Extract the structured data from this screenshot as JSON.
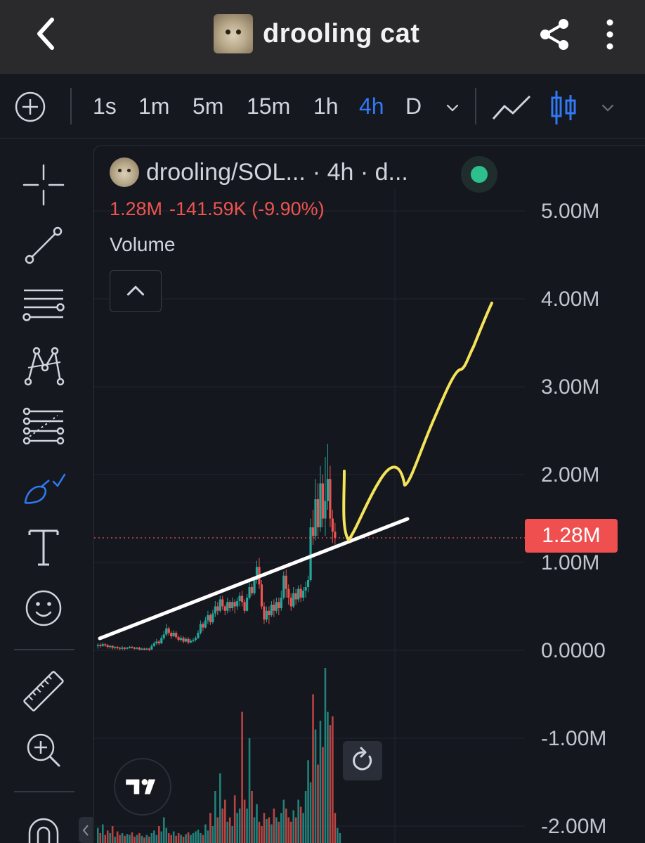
{
  "header": {
    "title": "drooling cat",
    "icons": [
      "back-icon",
      "share-icon",
      "more-icon"
    ]
  },
  "timeframes": {
    "items": [
      "1s",
      "1m",
      "5m",
      "15m",
      "1h",
      "4h",
      "D"
    ],
    "active": "4h"
  },
  "sidebar": {
    "tools": [
      "crosshair-icon",
      "trend-line-icon",
      "horizontal-lines-icon",
      "pattern-icon",
      "fib-icon",
      "brush-icon",
      "text-icon",
      "emoji-icon",
      "ruler-icon",
      "zoom-in-icon",
      "magnet-icon"
    ],
    "active_tool": "brush-icon"
  },
  "legend": {
    "symbol": "drooling/SOL...",
    "interval": "· 4h · d...",
    "last": "1.28M",
    "change": "-141.59K (-9.90%)",
    "status_color": "#2cc08d"
  },
  "volume_title": "Volume",
  "price_axis": [
    "5.00M",
    "4.00M",
    "3.00M",
    "2.00M",
    "1.00M",
    "0.0000",
    "-1.00M",
    "-2.00M"
  ],
  "current_price": "1.28M",
  "colors": {
    "up": "#26a69a",
    "down": "#ef5350",
    "accent": "#3179f5",
    "drawing_line": "#ffffff",
    "drawing_brush": "#f5e35a"
  },
  "chart_data": {
    "type": "candlestick",
    "ylim": [
      -2.0,
      5.0
    ],
    "unit": "M",
    "last_price": 1.28,
    "candles": [
      [
        0.05,
        0.06,
        0.02,
        0.08
      ],
      [
        0.06,
        0.05,
        0.03,
        0.08
      ],
      [
        0.05,
        0.07,
        0.04,
        0.09
      ],
      [
        0.07,
        0.06,
        0.04,
        0.08
      ],
      [
        0.06,
        0.04,
        0.02,
        0.07
      ],
      [
        0.04,
        0.05,
        0.02,
        0.06
      ],
      [
        0.05,
        0.03,
        0.01,
        0.06
      ],
      [
        0.03,
        0.04,
        0.01,
        0.05
      ],
      [
        0.04,
        0.03,
        0.01,
        0.05
      ],
      [
        0.03,
        0.02,
        0.0,
        0.04
      ],
      [
        0.02,
        0.03,
        0.0,
        0.05
      ],
      [
        0.03,
        0.02,
        0.0,
        0.04
      ],
      [
        0.02,
        0.03,
        0.01,
        0.04
      ],
      [
        0.03,
        0.04,
        0.02,
        0.05
      ],
      [
        0.04,
        0.03,
        0.02,
        0.05
      ],
      [
        0.03,
        0.02,
        0.01,
        0.04
      ],
      [
        0.02,
        0.03,
        0.01,
        0.04
      ],
      [
        0.03,
        0.01,
        0.0,
        0.04
      ],
      [
        0.01,
        0.02,
        0.0,
        0.03
      ],
      [
        0.02,
        0.01,
        0.0,
        0.03
      ],
      [
        0.01,
        0.02,
        0.0,
        0.03
      ],
      [
        0.02,
        0.01,
        -0.01,
        0.03
      ],
      [
        0.01,
        0.05,
        0.0,
        0.07
      ],
      [
        0.05,
        0.08,
        0.04,
        0.1
      ],
      [
        0.08,
        0.1,
        0.06,
        0.13
      ],
      [
        0.1,
        0.08,
        0.06,
        0.12
      ],
      [
        0.08,
        0.14,
        0.07,
        0.17
      ],
      [
        0.14,
        0.18,
        0.12,
        0.22
      ],
      [
        0.18,
        0.25,
        0.16,
        0.3
      ],
      [
        0.25,
        0.2,
        0.17,
        0.27
      ],
      [
        0.2,
        0.16,
        0.13,
        0.22
      ],
      [
        0.16,
        0.2,
        0.15,
        0.23
      ],
      [
        0.2,
        0.15,
        0.13,
        0.22
      ],
      [
        0.15,
        0.12,
        0.1,
        0.17
      ],
      [
        0.12,
        0.14,
        0.1,
        0.17
      ],
      [
        0.14,
        0.1,
        0.08,
        0.16
      ],
      [
        0.1,
        0.13,
        0.09,
        0.15
      ],
      [
        0.13,
        0.09,
        0.07,
        0.15
      ],
      [
        0.09,
        0.11,
        0.08,
        0.13
      ],
      [
        0.11,
        0.12,
        0.09,
        0.14
      ],
      [
        0.12,
        0.14,
        0.1,
        0.16
      ],
      [
        0.14,
        0.2,
        0.13,
        0.23
      ],
      [
        0.2,
        0.3,
        0.18,
        0.34
      ],
      [
        0.3,
        0.26,
        0.22,
        0.32
      ],
      [
        0.26,
        0.34,
        0.25,
        0.38
      ],
      [
        0.34,
        0.4,
        0.3,
        0.45
      ],
      [
        0.4,
        0.32,
        0.29,
        0.42
      ],
      [
        0.32,
        0.42,
        0.3,
        0.46
      ],
      [
        0.42,
        0.5,
        0.38,
        0.56
      ],
      [
        0.5,
        0.45,
        0.4,
        0.55
      ],
      [
        0.45,
        0.58,
        0.43,
        0.62
      ],
      [
        0.58,
        0.5,
        0.46,
        0.62
      ],
      [
        0.5,
        0.45,
        0.4,
        0.52
      ],
      [
        0.45,
        0.55,
        0.42,
        0.6
      ],
      [
        0.55,
        0.48,
        0.44,
        0.57
      ],
      [
        0.48,
        0.55,
        0.45,
        0.6
      ],
      [
        0.55,
        0.5,
        0.42,
        0.58
      ],
      [
        0.5,
        0.56,
        0.46,
        0.6
      ],
      [
        0.56,
        0.62,
        0.5,
        0.66
      ],
      [
        0.62,
        0.55,
        0.5,
        0.68
      ],
      [
        0.55,
        0.45,
        0.42,
        0.58
      ],
      [
        0.45,
        0.6,
        0.44,
        0.64
      ],
      [
        0.6,
        0.72,
        0.58,
        0.8
      ],
      [
        0.72,
        0.65,
        0.62,
        0.76
      ],
      [
        0.65,
        0.8,
        0.63,
        0.84
      ],
      [
        0.8,
        0.95,
        0.76,
        1.02
      ],
      [
        0.95,
        0.75,
        0.7,
        1.05
      ],
      [
        0.75,
        0.5,
        0.47,
        0.8
      ],
      [
        0.5,
        0.35,
        0.3,
        0.55
      ],
      [
        0.35,
        0.45,
        0.32,
        0.5
      ],
      [
        0.45,
        0.4,
        0.3,
        0.5
      ],
      [
        0.4,
        0.52,
        0.38,
        0.56
      ],
      [
        0.52,
        0.45,
        0.38,
        0.58
      ],
      [
        0.45,
        0.55,
        0.42,
        0.6
      ],
      [
        0.55,
        0.48,
        0.4,
        0.6
      ],
      [
        0.48,
        0.6,
        0.45,
        0.68
      ],
      [
        0.6,
        0.85,
        0.58,
        0.9
      ],
      [
        0.85,
        0.7,
        0.6,
        0.92
      ],
      [
        0.7,
        0.6,
        0.52,
        0.75
      ],
      [
        0.6,
        0.5,
        0.45,
        0.65
      ],
      [
        0.5,
        0.65,
        0.48,
        0.72
      ],
      [
        0.65,
        0.58,
        0.52,
        0.7
      ],
      [
        0.58,
        0.7,
        0.55,
        0.74
      ],
      [
        0.7,
        0.6,
        0.55,
        0.75
      ],
      [
        0.6,
        0.68,
        0.56,
        0.72
      ],
      [
        0.68,
        0.72,
        0.6,
        0.78
      ],
      [
        0.72,
        0.8,
        0.66,
        0.85
      ],
      [
        0.8,
        1.4,
        0.78,
        1.5
      ],
      [
        1.4,
        1.3,
        1.2,
        1.6
      ],
      [
        1.3,
        1.72,
        1.25,
        1.95
      ],
      [
        1.72,
        1.4,
        1.3,
        1.9
      ],
      [
        1.4,
        1.9,
        1.35,
        2.1
      ],
      [
        1.9,
        1.5,
        1.4,
        2.0
      ],
      [
        1.5,
        1.7,
        1.3,
        2.2
      ],
      [
        1.7,
        1.95,
        1.6,
        2.35
      ],
      [
        1.95,
        1.5,
        1.4,
        2.1
      ],
      [
        1.5,
        1.35,
        1.22,
        1.6
      ],
      [
        1.35,
        1.28,
        1.2,
        1.45
      ]
    ],
    "volumes": [
      0.18,
      0.12,
      0.22,
      0.1,
      0.15,
      0.12,
      0.2,
      0.08,
      0.14,
      0.1,
      0.12,
      0.09,
      0.11,
      0.1,
      0.13,
      0.08,
      0.1,
      0.12,
      0.09,
      0.07,
      0.1,
      0.08,
      0.12,
      0.15,
      0.1,
      0.2,
      0.14,
      0.3,
      0.18,
      0.12,
      0.1,
      0.14,
      0.09,
      0.12,
      0.1,
      0.08,
      0.11,
      0.13,
      0.1,
      0.12,
      0.14,
      0.16,
      0.12,
      0.1,
      0.22,
      0.15,
      0.35,
      0.2,
      0.6,
      0.3,
      0.8,
      0.4,
      0.5,
      0.25,
      0.3,
      0.2,
      0.55,
      0.35,
      0.4,
      1.5,
      0.5,
      0.4,
      1.2,
      0.6,
      0.3,
      0.45,
      0.25,
      0.2,
      0.35,
      0.28,
      0.3,
      0.22,
      0.4,
      0.3,
      0.25,
      0.35,
      0.5,
      0.4,
      0.3,
      0.25,
      0.38,
      0.3,
      0.5,
      0.42,
      0.35,
      0.6,
      0.95,
      0.7,
      1.7,
      1.3,
      0.9,
      1.4,
      1.1,
      2.0,
      1.5,
      1.35,
      1.45,
      0.35,
      0.18,
      0.12
    ]
  }
}
